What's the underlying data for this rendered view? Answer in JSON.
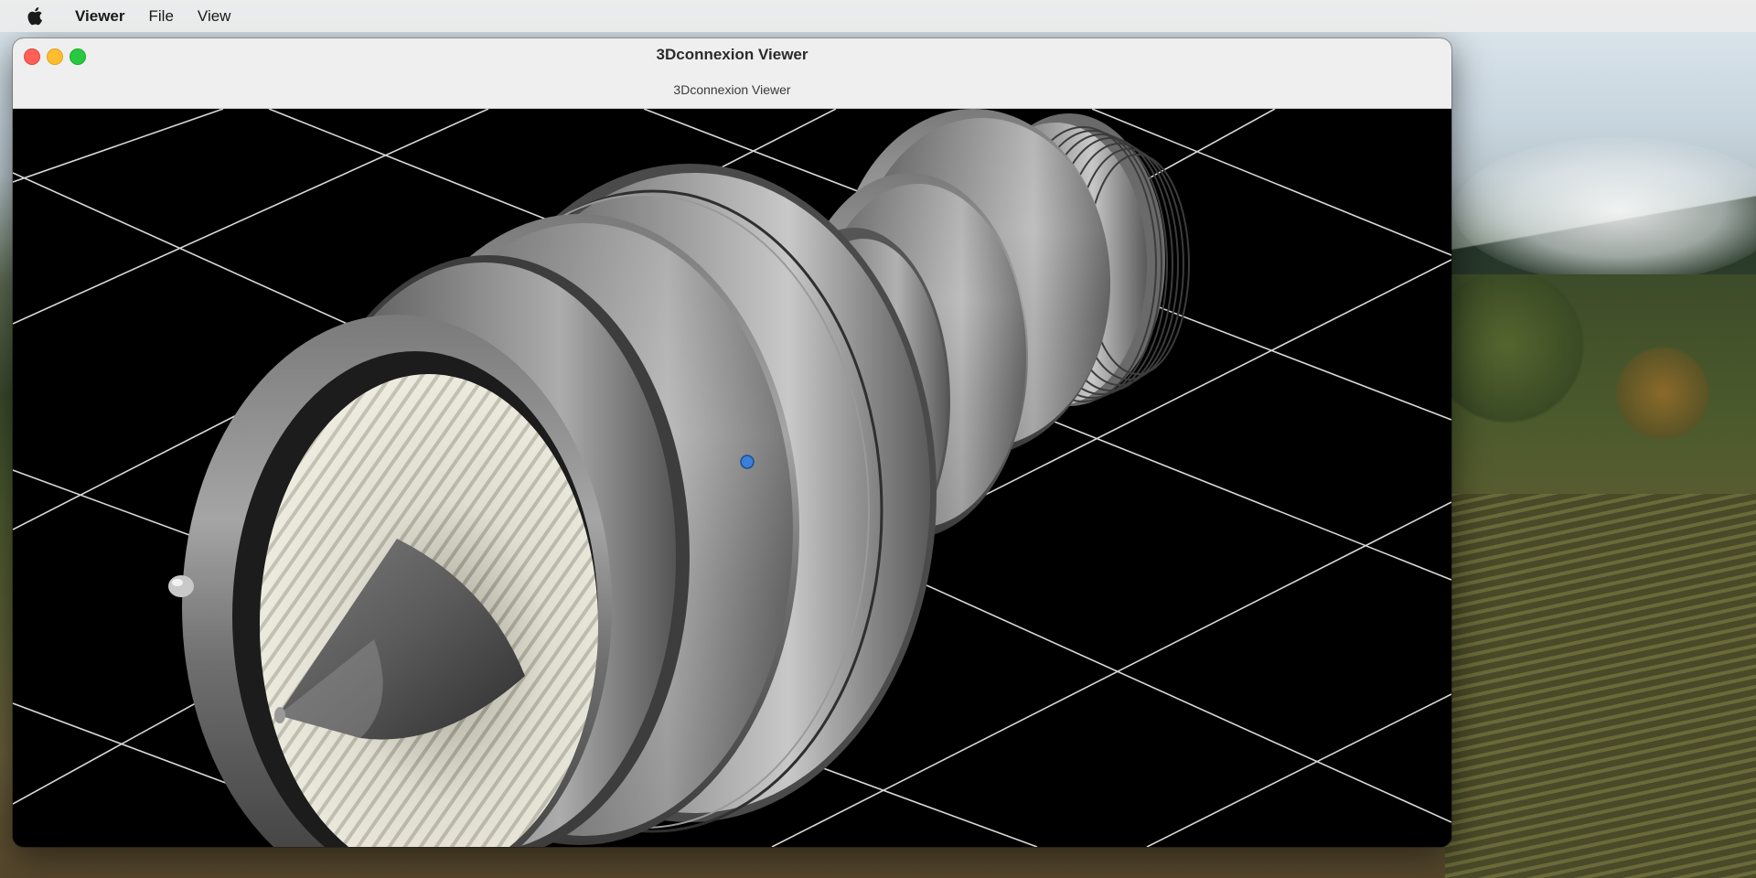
{
  "menubar": {
    "apple_icon": "apple-icon",
    "app_name": "Viewer",
    "items": [
      {
        "label": "File"
      },
      {
        "label": "View"
      }
    ]
  },
  "window": {
    "title": "3Dconnexion Viewer",
    "subtitle": "3Dconnexion Viewer",
    "controls": [
      "close",
      "minimize",
      "zoom"
    ]
  },
  "viewport": {
    "model": "turbofan-engine-model",
    "background": "#000000",
    "grid_color": "#d9d9d9",
    "pivot_color": "#3b7fd9"
  },
  "colors": {
    "close": "#ff5f57",
    "minimize": "#febc2e",
    "zoom": "#28c840"
  }
}
